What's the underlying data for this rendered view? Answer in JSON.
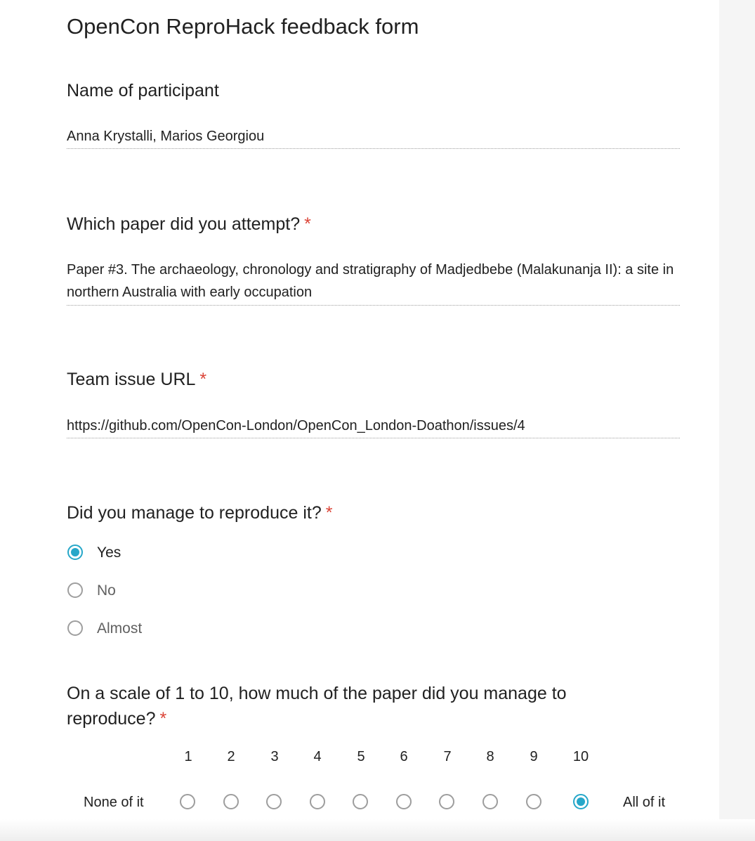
{
  "form": {
    "title": "OpenCon ReproHack feedback form"
  },
  "questions": {
    "participant": {
      "title": "Name of participant",
      "answer": "Anna Krystalli, Marios Georgiou"
    },
    "paper": {
      "title": "Which paper did you attempt?",
      "required_mark": "*",
      "answer": "Paper #3. The archaeology, chronology and stratigraphy of Madjedbebe (Malakunanja II): a site in northern Australia with early occupation"
    },
    "issue_url": {
      "title": "Team issue URL",
      "required_mark": "*",
      "answer": "https://github.com/OpenCon-London/OpenCon_London-Doathon/issues/4"
    },
    "reproduce": {
      "title": "Did you manage to reproduce it?",
      "required_mark": "*",
      "options": [
        "Yes",
        "No",
        "Almost"
      ],
      "selected": "Yes"
    },
    "scale": {
      "title_line1": "On a scale of 1 to 10, how much of the paper did you manage to",
      "title_line2": "reproduce?",
      "required_mark": "*",
      "numbers": [
        "1",
        "2",
        "3",
        "4",
        "5",
        "6",
        "7",
        "8",
        "9",
        "10"
      ],
      "low_label": "None of it",
      "high_label": "All of it",
      "selected": "10"
    }
  },
  "colors": {
    "accent": "#26a7c9",
    "required": "#db4437",
    "radio_border": "#9e9e9e"
  }
}
